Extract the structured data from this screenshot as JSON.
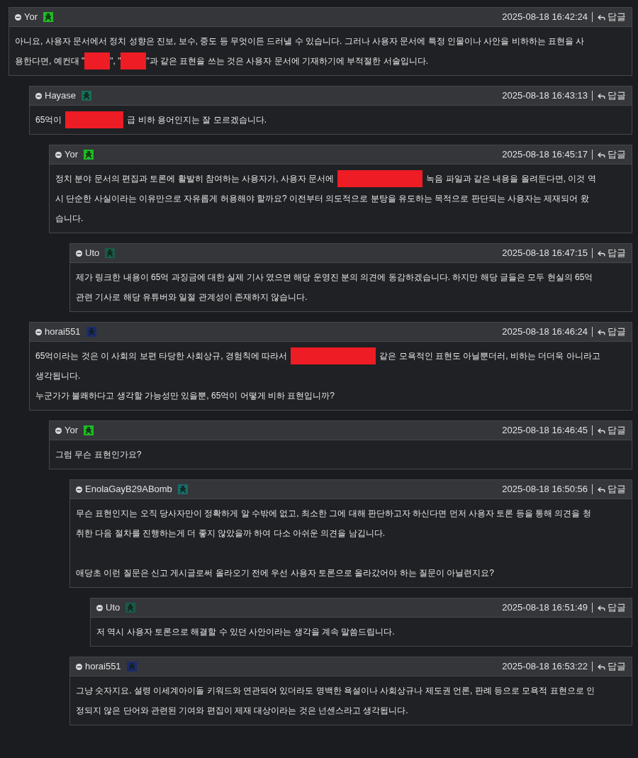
{
  "comments": [
    {
      "author": "Yor",
      "color": "#1fb924",
      "time": "2025-08-18 16:42:24",
      "reply": "답글",
      "lines": [
        {
          "kind": "text",
          "segments": [
            {
              "kind": "text",
              "text": "아니요, 사용자 문서에서 정치 성향은 진보, 보수, 중도 등 무엇이든 드러낼 수 있습니다. 그러나 사용자 문서에 특정 인물이나 사안을 비하하는 표현을 사"
            }
          ]
        },
        {
          "kind": "text",
          "segments": [
            {
              "kind": "text",
              "text": "용한다면, 예컨대 \""
            },
            {
              "kind": "mask"
            },
            {
              "kind": "text",
              "text": "\", \""
            },
            {
              "kind": "mask"
            },
            {
              "kind": "text",
              "text": "\"과 같은 표현을 쓰는 것은 사용자 문서에 기재하기에 부적절한 서술입니다."
            }
          ]
        }
      ],
      "children": [
        {
          "author": "Hayase",
          "color": "#1a6b5a",
          "time": "2025-08-18 16:43:13",
          "reply": "답글",
          "lines": [
            {
              "kind": "text",
              "segments": [
                {
                  "kind": "text",
                  "text": "65억이"
                },
                {
                  "kind": "block"
                },
                {
                  "kind": "text",
                  "text": "급 비하 용어인지는 잘 모르겠습니다."
                }
              ]
            }
          ],
          "children": [
            {
              "author": "Yor",
              "color": "#1fb924",
              "time": "2025-08-18 16:45:17",
              "reply": "답글",
              "lines": [
                {
                  "kind": "text",
                  "segments": [
                    {
                      "kind": "text",
                      "text": "정치 분야 문서의 편집과 토론에 활발히 참여하는 사용자가, 사용자 문서에"
                    },
                    {
                      "kind": "bar"
                    },
                    {
                      "kind": "text",
                      "text": "녹음 파일과 같은 내용을 올려둔다면, 이것 역"
                    }
                  ]
                },
                {
                  "kind": "text",
                  "segments": [
                    {
                      "kind": "text",
                      "text": "시 단순한 사실이라는 이유만으로 자유롭게 허용해야 할까요? 이전부터 의도적으로 분탕을 유도하는 목적으로 판단되는 사용자는 제재되어 왔"
                    }
                  ]
                },
                {
                  "kind": "text",
                  "segments": [
                    {
                      "kind": "text",
                      "text": "습니다."
                    }
                  ]
                }
              ],
              "children": [
                {
                  "author": "Uto",
                  "color": "#1a5a4a",
                  "time": "2025-08-18 16:47:15",
                  "reply": "답글",
                  "lines": [
                    {
                      "kind": "text",
                      "segments": [
                        {
                          "kind": "text",
                          "text": "제가 링크한 내용이 65억 과징금에 대한 실제 기사 였으면 해당 운영진 분의 의견에 동감하겠습니다. 하지만 해당 글들은 모두 현실의 65억"
                        }
                      ]
                    },
                    {
                      "kind": "text",
                      "segments": [
                        {
                          "kind": "text",
                          "text": "관련 기사로 해당 유튜버와 일절 관계성이 존재하지 않습니다."
                        }
                      ]
                    }
                  ]
                }
              ]
            }
          ]
        },
        {
          "author": "horai551",
          "color": "#1c2a6e",
          "time": "2025-08-18 16:46:24",
          "reply": "답글",
          "lines": [
            {
              "kind": "text",
              "segments": [
                {
                  "kind": "text",
                  "text": "65억이라는 것은 이 사회의 보편 타당한 사회상규, 경험칙에 따라서"
                },
                {
                  "kind": "bar"
                },
                {
                  "kind": "text",
                  "text": "같은 모욕적인 표현도 아닐뿐더러, 비하는 더더욱 아니라고"
                }
              ]
            },
            {
              "kind": "text",
              "segments": [
                {
                  "kind": "text",
                  "text": "생각됩니다."
                }
              ]
            },
            {
              "kind": "text",
              "segments": [
                {
                  "kind": "text",
                  "text": "누군가가 불쾌하다고 생각할 가능성만 있을뿐, 65억이 어떻게 비하 표현입니까?"
                }
              ]
            }
          ],
          "children": [
            {
              "author": "Yor",
              "color": "#1fb924",
              "time": "2025-08-18 16:46:45",
              "reply": "답글",
              "lines": [
                {
                  "kind": "text",
                  "segments": [
                    {
                      "kind": "text",
                      "text": "그럼 무슨 표현인가요?"
                    }
                  ]
                }
              ],
              "children": [
                {
                  "author": "EnolaGayB29ABomb",
                  "color": "#1a6b6b",
                  "time": "2025-08-18 16:50:56",
                  "reply": "답글",
                  "lines": [
                    {
                      "kind": "text",
                      "segments": [
                        {
                          "kind": "text",
                          "text": "무슨 표현인지는 오직 당사자만이 정확하게 알 수밖에 없고, 최소한 그에 대해 판단하고자 하신다면 먼저 사용자 토론 등을 통해 의견을 청"
                        }
                      ]
                    },
                    {
                      "kind": "text",
                      "segments": [
                        {
                          "kind": "text",
                          "text": "취한 다음 절차를 진행하는게 더 좋지 않았을까 하여 다소 아쉬운 의견을 남깁니다."
                        }
                      ]
                    },
                    {
                      "kind": "blank"
                    },
                    {
                      "kind": "text",
                      "segments": [
                        {
                          "kind": "text",
                          "text": "애당초 이런 질문은 신고 게시글로써 올라오기 전에 우선 사용자 토론으로 올라갔어야 하는 질문이 아닐련지요?"
                        }
                      ]
                    }
                  ],
                  "children": [
                    {
                      "author": "Uto",
                      "color": "#1a5a4a",
                      "time": "2025-08-18 16:51:49",
                      "reply": "답글",
                      "lines": [
                        {
                          "kind": "text",
                          "segments": [
                            {
                              "kind": "text",
                              "text": "저 역시 사용자 토론으로 해결할 수 있던 사안이라는 생각을 계속 말씀드립니다."
                            }
                          ]
                        }
                      ]
                    }
                  ]
                },
                {
                  "author": "horai551",
                  "color": "#1c2a6e",
                  "time": "2025-08-18 16:53:22",
                  "reply": "답글",
                  "lines": [
                    {
                      "kind": "text",
                      "segments": [
                        {
                          "kind": "text",
                          "text": "그냥 숫자지요. 설령 이세계아이돌 키워드와 연관되어 있더라도 명백한 욕설이나 사회상규나 제도권 언론, 판례 등으로 모욕적 표현으로 인"
                        }
                      ]
                    },
                    {
                      "kind": "text",
                      "segments": [
                        {
                          "kind": "text",
                          "text": "정되지 않은 단어와 관련된 기여와 편집이 제재 대상이라는 것은 넌센스라고 생각됩니다."
                        }
                      ]
                    }
                  ]
                }
              ]
            }
          ]
        }
      ]
    }
  ]
}
